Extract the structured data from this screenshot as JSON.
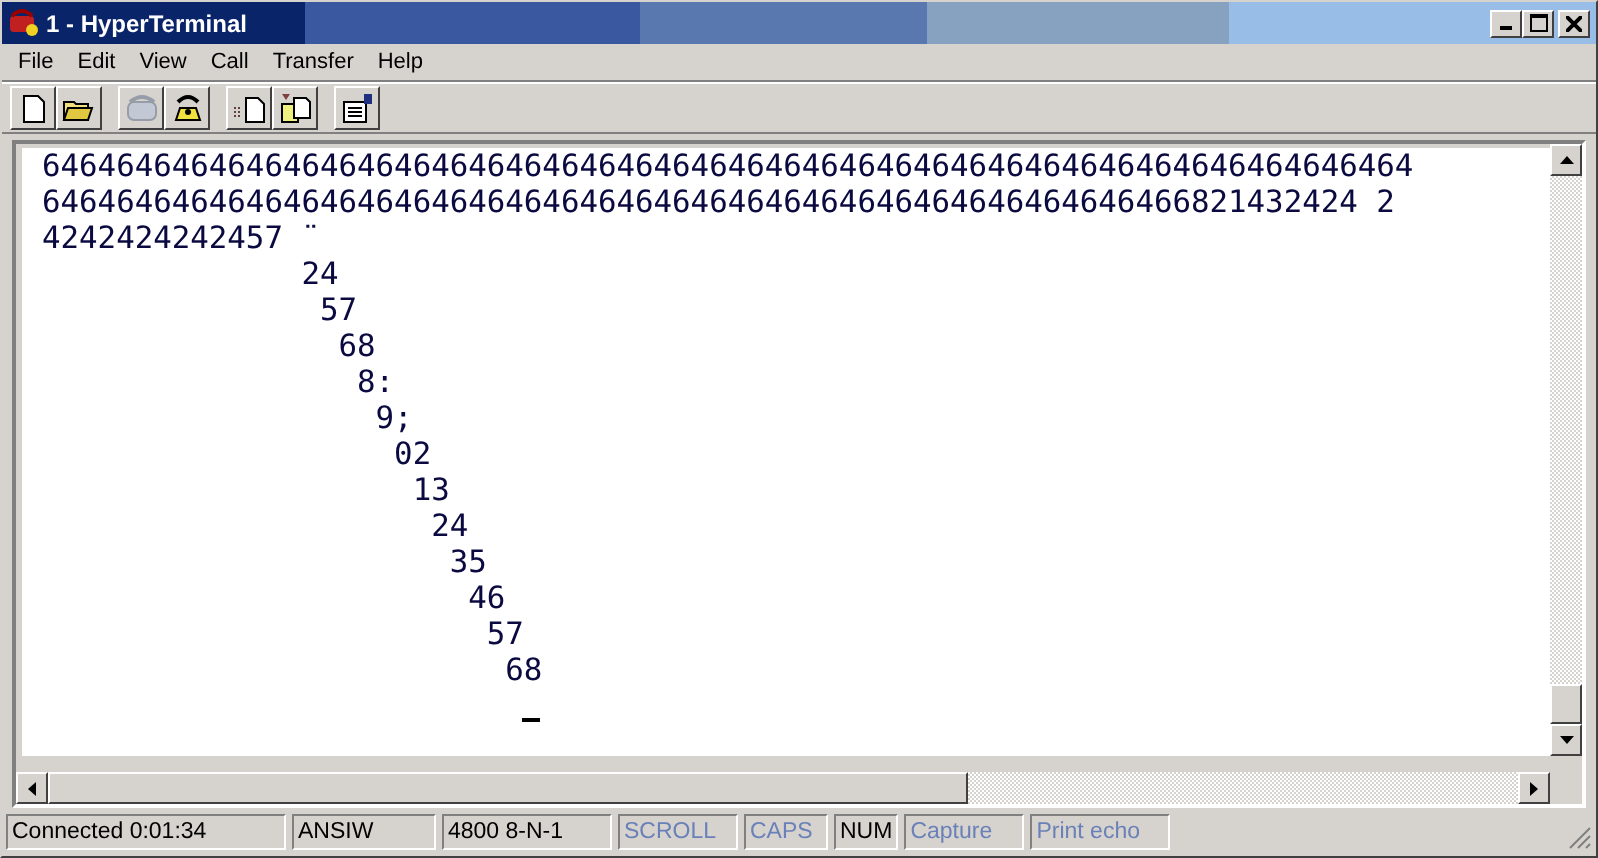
{
  "window": {
    "title": "1 - HyperTerminal"
  },
  "menu": [
    "File",
    "Edit",
    "View",
    "Call",
    "Transfer",
    "Help"
  ],
  "toolbar_groups": [
    [
      {
        "kind": "new",
        "disabled": false
      },
      {
        "kind": "open",
        "disabled": false
      }
    ],
    [
      {
        "kind": "connect",
        "disabled": true
      },
      {
        "kind": "disconnect",
        "disabled": false
      }
    ],
    [
      {
        "kind": "send",
        "disabled": false
      },
      {
        "kind": "receive",
        "disabled": false
      }
    ],
    [
      {
        "kind": "properties",
        "disabled": false
      }
    ]
  ],
  "terminal_lines": [
    "64646464646464646464646464646464646464646464646464646464646464646464646464",
    "64646464646464646464646464646464646464646464646464646464646466821432424 2",
    "4242424242457 ¨",
    "              24",
    "               57",
    "                68",
    "                 8:",
    "                  9;",
    "                   02",
    "                    13",
    "                     24",
    "                      35",
    "                       46",
    "                        57",
    "                         68"
  ],
  "status_bar": [
    {
      "text": "Connected 0:01:34",
      "active": true
    },
    {
      "text": "ANSIW",
      "active": true
    },
    {
      "text": "4800 8-N-1",
      "active": true
    },
    {
      "text": "SCROLL",
      "active": false
    },
    {
      "text": "CAPS",
      "active": false
    },
    {
      "text": "NUM",
      "active": true
    },
    {
      "text": "Capture",
      "active": false
    },
    {
      "text": "Print echo",
      "active": false
    }
  ]
}
